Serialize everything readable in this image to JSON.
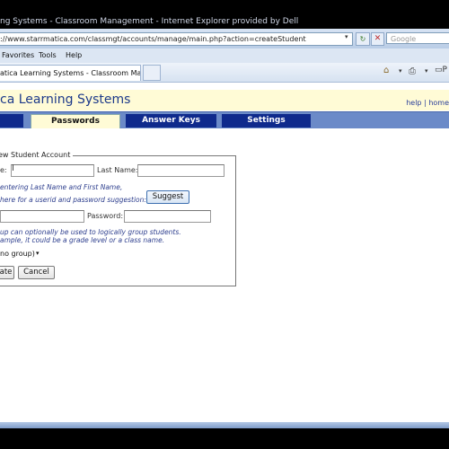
{
  "window": {
    "title": "ng Systems - Classroom Management - Internet Explorer provided by Dell"
  },
  "addressbar": {
    "url": "://www.starrmatica.com/classmgt/accounts/manage/main.php?action=createStudent",
    "search_placeholder": "Google"
  },
  "menu": {
    "items": [
      "Favorites",
      "Tools",
      "Help"
    ]
  },
  "browser_tab": {
    "title": "atica Learning Systems - Classroom Mana...",
    "page_label": "P"
  },
  "header": {
    "title": "ca Learning Systems",
    "help_link": "help",
    "separator": "|",
    "home_link": "home"
  },
  "nav": {
    "tabs": [
      {
        "label": "Passwords",
        "active": true
      },
      {
        "label": "Answer Keys",
        "active": false
      },
      {
        "label": "Settings",
        "active": false
      }
    ]
  },
  "form": {
    "legend": "ew Student Account",
    "first_name_label": "e:",
    "last_name_label": "Last Name:",
    "note_names": "entering Last Name and First Name,",
    "note_suggest": "here for a userid and password suggestion:",
    "suggest_button": "Suggest",
    "password_label": "Password:",
    "note_group_1": "up can optionally be used to logically group students.",
    "note_group_2": "ample, it could be a grade level or a class name.",
    "group_select_value": "no group)",
    "create_button": "ate",
    "cancel_button": "Cancel"
  },
  "colors": {
    "title_blue": "#1d3a8a",
    "nav_tab_bg": "#0f2a8c",
    "header_bg": "#fffbd6",
    "note_blue": "#2e3f8e"
  }
}
